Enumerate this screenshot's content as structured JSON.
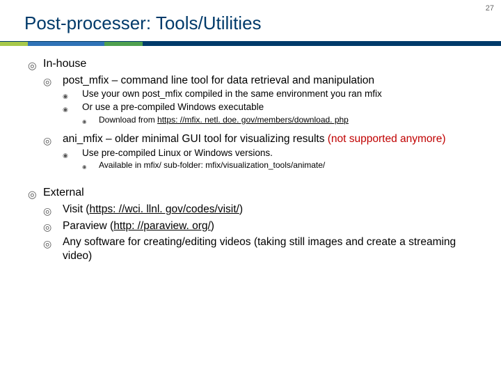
{
  "pageNumber": "27",
  "title": "Post-processer: Tools/Utilities",
  "sections": {
    "inhouse": {
      "heading": "In-house",
      "post_mfix": {
        "label": "post_mfix – command line tool for data retrieval and manipulation",
        "use_own": "Use your own post_mfix compiled in the same environment you ran mfix",
        "precompiled": "Or use a pre-compiled Windows executable",
        "download_prefix": "Download from ",
        "download_link": "https: //mfix. netl. doe. gov/members/download. php"
      },
      "ani_mfix": {
        "label_pre": "ani_mfix – older minimal GUI tool for visualizing results ",
        "label_red": "(not supported anymore)",
        "use_precompiled": "Use pre-compiled Linux or Windows versions.",
        "available": "Available in mfix/ sub-folder: mfix/visualization_tools/animate/"
      }
    },
    "external": {
      "heading": "External",
      "visit": {
        "name": "Visit (",
        "link": "https: //wci. llnl. gov/codes/visit/",
        "close": ")"
      },
      "paraview": {
        "name": "Paraview (",
        "link": "http: //paraview. org/",
        "close": ")"
      },
      "any_software": "Any software for creating/editing videos (taking still images and create a streaming video)"
    }
  }
}
